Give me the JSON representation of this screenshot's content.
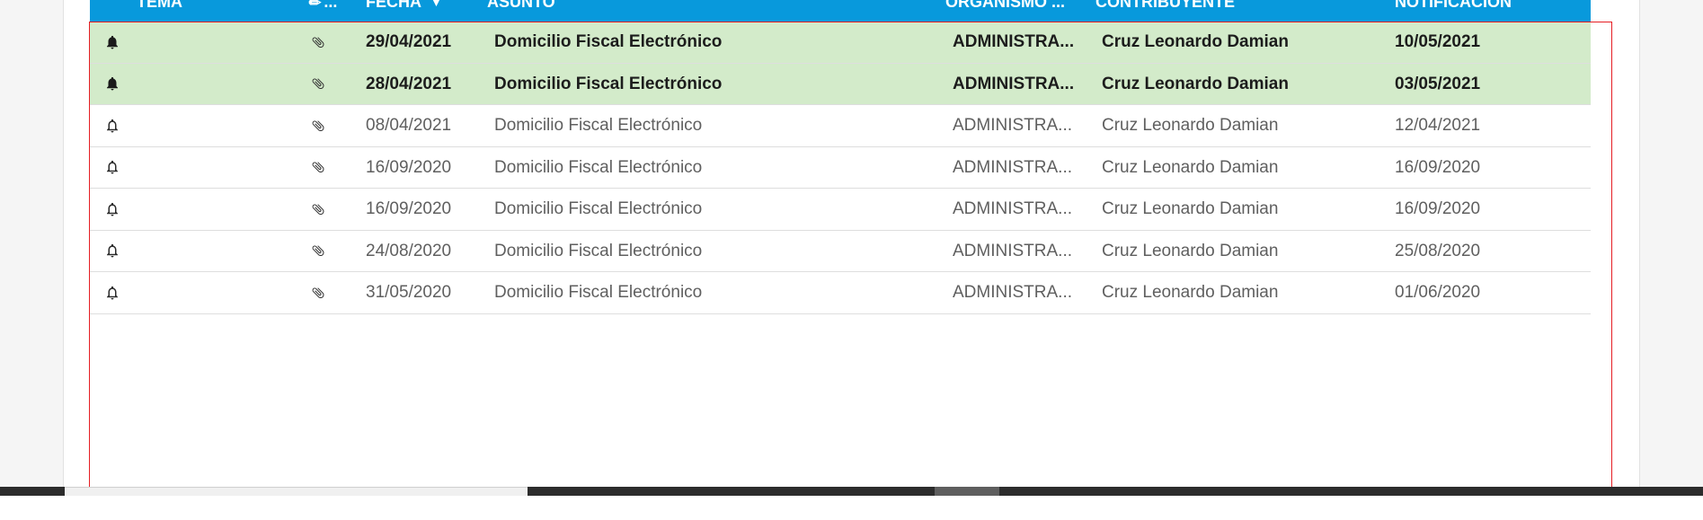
{
  "table": {
    "headers": {
      "tema": "TEMA",
      "adjuntos_icon": "paperclip-icon",
      "adjuntos_suffix": "...",
      "fecha": "FECHA",
      "fecha_sort_icon": "caret-down-icon",
      "asunto": "ASUNTO",
      "organismo": "ORGANISMO ...",
      "contribuyente": "CONTRIBUYENTE",
      "notificacion": "NOTIFICACIÓN"
    },
    "rows": [
      {
        "status": "unread",
        "bell_icon": "bell-filled-icon",
        "clip_icon": "paperclip-icon",
        "fecha": "29/04/2021",
        "asunto": "Domicilio Fiscal Electrónico",
        "organismo": "ADMINISTRA...",
        "contribuyente": "Cruz Leonardo Damian",
        "notificacion": "10/05/2021"
      },
      {
        "status": "unread",
        "bell_icon": "bell-filled-icon",
        "clip_icon": "paperclip-icon",
        "fecha": "28/04/2021",
        "asunto": "Domicilio Fiscal Electrónico",
        "organismo": "ADMINISTRA...",
        "contribuyente": "Cruz Leonardo Damian",
        "notificacion": "03/05/2021"
      },
      {
        "status": "read",
        "bell_icon": "bell-outline-icon",
        "clip_icon": "paperclip-icon",
        "fecha": "08/04/2021",
        "asunto": "Domicilio Fiscal Electrónico",
        "organismo": "ADMINISTRA...",
        "contribuyente": "Cruz Leonardo Damian",
        "notificacion": "12/04/2021"
      },
      {
        "status": "read",
        "bell_icon": "bell-outline-icon",
        "clip_icon": "paperclip-icon",
        "fecha": "16/09/2020",
        "asunto": "Domicilio Fiscal Electrónico",
        "organismo": "ADMINISTRA...",
        "contribuyente": "Cruz Leonardo Damian",
        "notificacion": "16/09/2020"
      },
      {
        "status": "read",
        "bell_icon": "bell-outline-icon",
        "clip_icon": "paperclip-icon",
        "fecha": "16/09/2020",
        "asunto": "Domicilio Fiscal Electrónico",
        "organismo": "ADMINISTRA...",
        "contribuyente": "Cruz Leonardo Damian",
        "notificacion": "16/09/2020"
      },
      {
        "status": "read",
        "bell_icon": "bell-outline-icon",
        "clip_icon": "paperclip-icon",
        "fecha": "24/08/2020",
        "asunto": "Domicilio Fiscal Electrónico",
        "organismo": "ADMINISTRA...",
        "contribuyente": "Cruz Leonardo Damian",
        "notificacion": "25/08/2020"
      },
      {
        "status": "read",
        "bell_icon": "bell-outline-icon",
        "clip_icon": "paperclip-icon",
        "fecha": "31/05/2020",
        "asunto": "Domicilio Fiscal Electrónico",
        "organismo": "ADMINISTRA...",
        "contribuyente": "Cruz Leonardo Damian",
        "notificacion": "01/06/2020"
      }
    ]
  },
  "colors": {
    "header_bg": "#0899dc",
    "unread_row_bg": "#d3ebca",
    "selection_outline": "#e51d23"
  }
}
